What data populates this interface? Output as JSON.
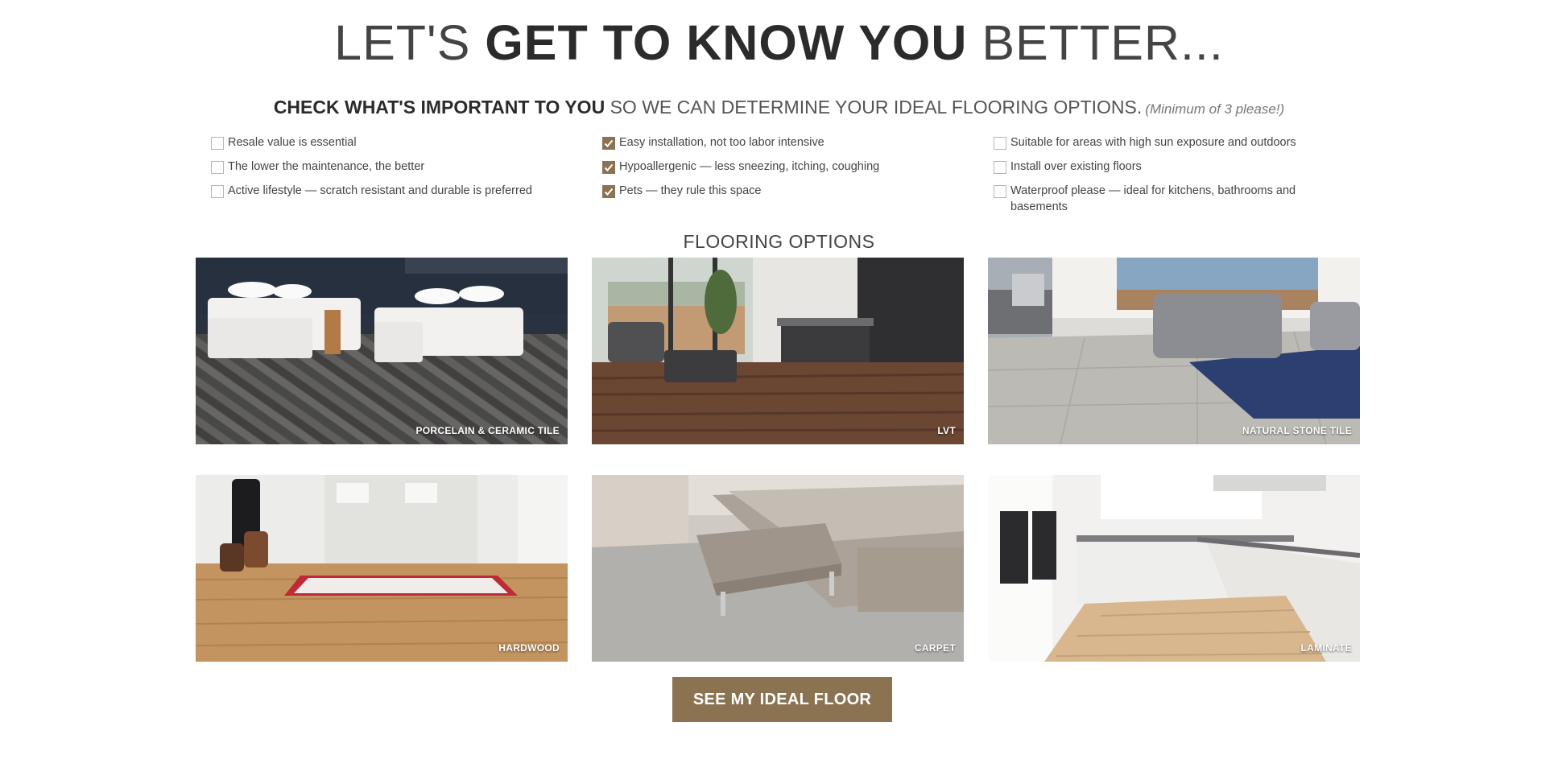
{
  "header": {
    "headline_pre": "LET'S ",
    "headline_bold": "GET TO KNOW YOU",
    "headline_post": " BETTER...",
    "sub_bold": "CHECK WHAT'S IMPORTANT TO YOU",
    "sub_rest": " SO WE CAN DETERMINE YOUR IDEAL FLOORING OPTIONS.",
    "sub_note": "(Minimum of 3 please!)"
  },
  "checklist": {
    "col1": [
      {
        "label": "Resale value is essential",
        "checked": false
      },
      {
        "label": "The lower the maintenance, the better",
        "checked": false
      },
      {
        "label": "Active lifestyle — scratch resistant and durable is preferred",
        "checked": false
      }
    ],
    "col2": [
      {
        "label": "Easy installation, not too labor intensive",
        "checked": true
      },
      {
        "label": "Hypoallergenic — less sneezing, itching, coughing",
        "checked": true
      },
      {
        "label": "Pets — they rule this space",
        "checked": true
      }
    ],
    "col3": [
      {
        "label": "Suitable for areas with high sun exposure and outdoors",
        "checked": false
      },
      {
        "label": "Install over existing floors",
        "checked": false
      },
      {
        "label": "Waterproof please — ideal for kitchens, bathrooms and basements",
        "checked": false
      }
    ]
  },
  "section_title": "FLOORING OPTIONS",
  "flooring_options": [
    {
      "caption": "PORCELAIN & CERAMIC TILE"
    },
    {
      "caption": "LVT"
    },
    {
      "caption": "NATURAL STONE TILE"
    },
    {
      "caption": "HARDWOOD"
    },
    {
      "caption": "CARPET"
    },
    {
      "caption": "LAMINATE"
    }
  ],
  "cta_label": "SEE MY IDEAL FLOOR",
  "colors": {
    "accent": "#8b7352",
    "heading": "#2b2b2b",
    "text": "#444444"
  }
}
